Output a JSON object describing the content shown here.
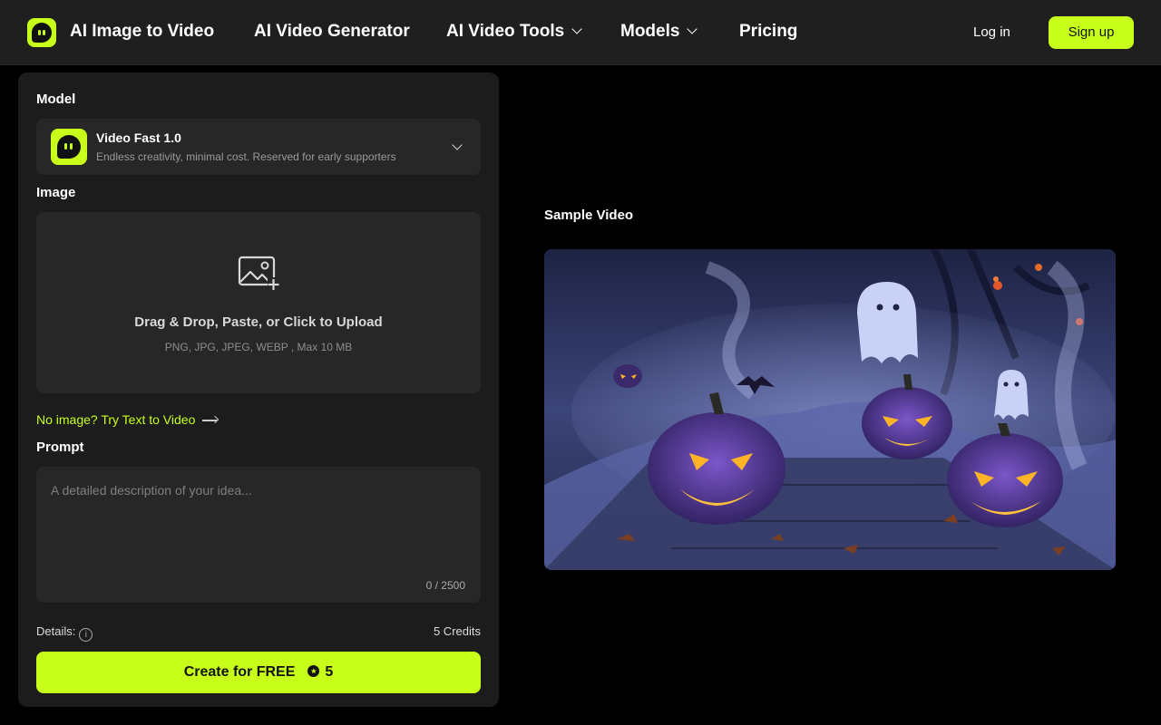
{
  "header": {
    "brand": "AI Image to Video",
    "nav": [
      {
        "label": "AI Video Generator"
      },
      {
        "label": "AI Video Tools"
      },
      {
        "label": "Models"
      },
      {
        "label": "Pricing"
      }
    ],
    "login": "Log in",
    "signup": "Sign up"
  },
  "form": {
    "model_label": "Model",
    "model_name": "Video Fast 1.0",
    "model_desc": "Endless creativity, minimal cost. Reserved for early supporters",
    "image_label": "Image",
    "upload_title": "Drag & Drop, Paste, or Click to Upload",
    "upload_sub": "PNG, JPG, JPEG, WEBP , Max 10 MB",
    "try_link": "No image? Try Text to Video",
    "prompt_label": "Prompt",
    "prompt_placeholder": "A detailed description of your idea...",
    "counter": "0 / 2500",
    "details_label": "Details:",
    "info_glyph": "i",
    "credits": "5 Credits",
    "create_label": "Create for FREE",
    "create_cost": "5"
  },
  "preview": {
    "sample_label": "Sample Video"
  },
  "colors": {
    "accent": "#c8ff1a",
    "header_bg": "#1f1f1f",
    "panel_bg": "#1c1c1c",
    "field_bg": "#272727",
    "page_bg": "#000000"
  },
  "icons": [
    "app-logo-icon",
    "chevron-down-icon",
    "image-add-icon",
    "arrow-right-icon",
    "info-icon",
    "coin-icon"
  ]
}
